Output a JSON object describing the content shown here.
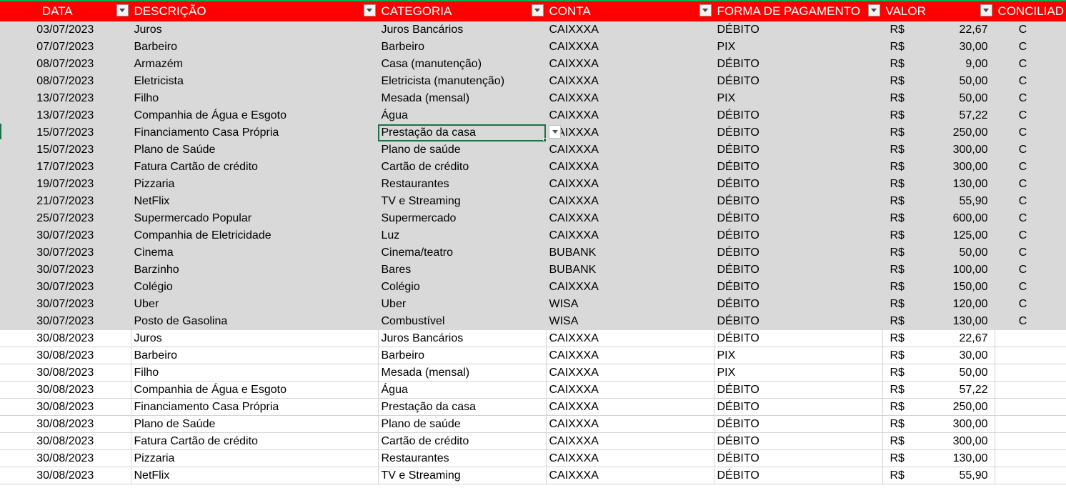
{
  "headers": {
    "data": "DATA",
    "descricao": "DESCRIÇÃO",
    "categoria": "CATEGORIA",
    "conta": "CONTA",
    "forma": "FORMA DE PAGAMENTO",
    "valor": "VALOR",
    "conciliado": "CONCILIAD"
  },
  "currency": "R$",
  "colors": {
    "header_bg": "#ff0000",
    "reconciled_bg": "#d9d9d9",
    "selection": "#1e7145"
  },
  "rows": [
    {
      "data": "03/07/2023",
      "descricao": "Juros",
      "categoria": "Juros Bancários",
      "conta": "CAIXXXA",
      "forma": "DÉBITO",
      "valor": "22,67",
      "conciliado": "C"
    },
    {
      "data": "07/07/2023",
      "descricao": "Barbeiro",
      "categoria": "Barbeiro",
      "conta": "CAIXXXA",
      "forma": "PIX",
      "valor": "30,00",
      "conciliado": "C"
    },
    {
      "data": "08/07/2023",
      "descricao": "Armazém",
      "categoria": "Casa (manutenção)",
      "conta": "CAIXXXA",
      "forma": "DÉBITO",
      "valor": "9,00",
      "conciliado": "C"
    },
    {
      "data": "08/07/2023",
      "descricao": "Eletricista",
      "categoria": "Eletricista (manutenção)",
      "conta": "CAIXXXA",
      "forma": "DÉBITO",
      "valor": "50,00",
      "conciliado": "C"
    },
    {
      "data": "13/07/2023",
      "descricao": "Filho",
      "categoria": "Mesada (mensal)",
      "conta": "CAIXXXA",
      "forma": "PIX",
      "valor": "50,00",
      "conciliado": "C"
    },
    {
      "data": "13/07/2023",
      "descricao": "Companhia de Água e Esgoto",
      "categoria": "Água",
      "conta": "CAIXXXA",
      "forma": "DÉBITO",
      "valor": "57,22",
      "conciliado": "C"
    },
    {
      "data": "15/07/2023",
      "descricao": "Financiamento Casa Própria",
      "categoria": "Prestação da casa",
      "conta": "CAIXXXA",
      "forma": "DÉBITO",
      "valor": "250,00",
      "conciliado": "C"
    },
    {
      "data": "15/07/2023",
      "descricao": "Plano de Saúde",
      "categoria": "Plano de saúde",
      "conta": "CAIXXXA",
      "forma": "DÉBITO",
      "valor": "300,00",
      "conciliado": "C"
    },
    {
      "data": "17/07/2023",
      "descricao": "Fatura Cartão de crédito",
      "categoria": "Cartão de crédito",
      "conta": "CAIXXXA",
      "forma": "DÉBITO",
      "valor": "300,00",
      "conciliado": "C"
    },
    {
      "data": "19/07/2023",
      "descricao": "Pizzaria",
      "categoria": "Restaurantes",
      "conta": "CAIXXXA",
      "forma": "DÉBITO",
      "valor": "130,00",
      "conciliado": "C"
    },
    {
      "data": "21/07/2023",
      "descricao": "NetFlix",
      "categoria": "TV e Streaming",
      "conta": "CAIXXXA",
      "forma": "DÉBITO",
      "valor": "55,90",
      "conciliado": "C"
    },
    {
      "data": "25/07/2023",
      "descricao": "Supermercado Popular",
      "categoria": "Supermercado",
      "conta": "CAIXXXA",
      "forma": "DÉBITO",
      "valor": "600,00",
      "conciliado": "C"
    },
    {
      "data": "30/07/2023",
      "descricao": "Companhia de Eletricidade",
      "categoria": "Luz",
      "conta": "CAIXXXA",
      "forma": "DÉBITO",
      "valor": "125,00",
      "conciliado": "C"
    },
    {
      "data": "30/07/2023",
      "descricao": "Cinema",
      "categoria": "Cinema/teatro",
      "conta": "BUBANK",
      "forma": "DÉBITO",
      "valor": "50,00",
      "conciliado": "C"
    },
    {
      "data": "30/07/2023",
      "descricao": "Barzinho",
      "categoria": "Bares",
      "conta": "BUBANK",
      "forma": "DÉBITO",
      "valor": "100,00",
      "conciliado": "C"
    },
    {
      "data": "30/07/2023",
      "descricao": "Colégio",
      "categoria": "Colégio",
      "conta": "CAIXXXA",
      "forma": "DÉBITO",
      "valor": "150,00",
      "conciliado": "C"
    },
    {
      "data": "30/07/2023",
      "descricao": "Uber",
      "categoria": "Uber",
      "conta": "WISA",
      "forma": "DÉBITO",
      "valor": "120,00",
      "conciliado": "C"
    },
    {
      "data": "30/07/2023",
      "descricao": "Posto de Gasolina",
      "categoria": "Combustível",
      "conta": "WISA",
      "forma": "DÉBITO",
      "valor": "130,00",
      "conciliado": "C"
    },
    {
      "data": "30/08/2023",
      "descricao": "Juros",
      "categoria": "Juros Bancários",
      "conta": "CAIXXXA",
      "forma": "DÉBITO",
      "valor": "22,67",
      "conciliado": ""
    },
    {
      "data": "30/08/2023",
      "descricao": "Barbeiro",
      "categoria": "Barbeiro",
      "conta": "CAIXXXA",
      "forma": "PIX",
      "valor": "30,00",
      "conciliado": ""
    },
    {
      "data": "30/08/2023",
      "descricao": "Filho",
      "categoria": "Mesada (mensal)",
      "conta": "CAIXXXA",
      "forma": "PIX",
      "valor": "50,00",
      "conciliado": ""
    },
    {
      "data": "30/08/2023",
      "descricao": "Companhia de Água e Esgoto",
      "categoria": "Água",
      "conta": "CAIXXXA",
      "forma": "DÉBITO",
      "valor": "57,22",
      "conciliado": ""
    },
    {
      "data": "30/08/2023",
      "descricao": "Financiamento Casa Própria",
      "categoria": "Prestação da casa",
      "conta": "CAIXXXA",
      "forma": "DÉBITO",
      "valor": "250,00",
      "conciliado": ""
    },
    {
      "data": "30/08/2023",
      "descricao": "Plano de Saúde",
      "categoria": "Plano de saúde",
      "conta": "CAIXXXA",
      "forma": "DÉBITO",
      "valor": "300,00",
      "conciliado": ""
    },
    {
      "data": "30/08/2023",
      "descricao": "Fatura Cartão de crédito",
      "categoria": "Cartão de crédito",
      "conta": "CAIXXXA",
      "forma": "DÉBITO",
      "valor": "300,00",
      "conciliado": ""
    },
    {
      "data": "30/08/2023",
      "descricao": "Pizzaria",
      "categoria": "Restaurantes",
      "conta": "CAIXXXA",
      "forma": "DÉBITO",
      "valor": "130,00",
      "conciliado": ""
    },
    {
      "data": "30/08/2023",
      "descricao": "NetFlix",
      "categoria": "TV e Streaming",
      "conta": "CAIXXXA",
      "forma": "DÉBITO",
      "valor": "55,90",
      "conciliado": ""
    }
  ]
}
